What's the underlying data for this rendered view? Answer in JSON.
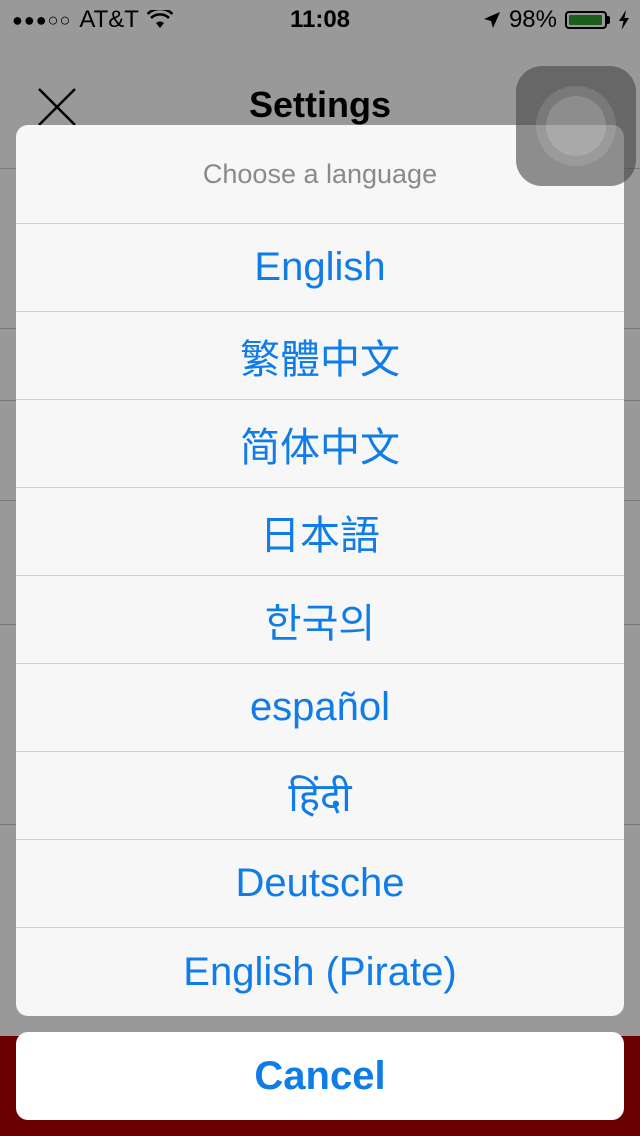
{
  "status_bar": {
    "signal": "●●●○○",
    "carrier": "AT&T",
    "wifi_icon": "wifi-icon",
    "time": "11:08",
    "location_icon": "location-arrow-icon",
    "battery_percent": "98%",
    "battery_level": 0.98,
    "charging_icon": "lightning-bolt-icon"
  },
  "nav": {
    "title": "Settings",
    "close_icon": "close-icon"
  },
  "action_sheet": {
    "title": "Choose a language",
    "options": [
      "English",
      "繁體中文",
      "简体中文",
      "日本語",
      "한국의",
      "español",
      "हिंदी",
      "Deutsche",
      "English (Pirate)"
    ],
    "cancel_label": "Cancel"
  },
  "colors": {
    "accent": "#107ce8",
    "brand_bar": "#b30000",
    "battery": "#2e9f2e"
  }
}
